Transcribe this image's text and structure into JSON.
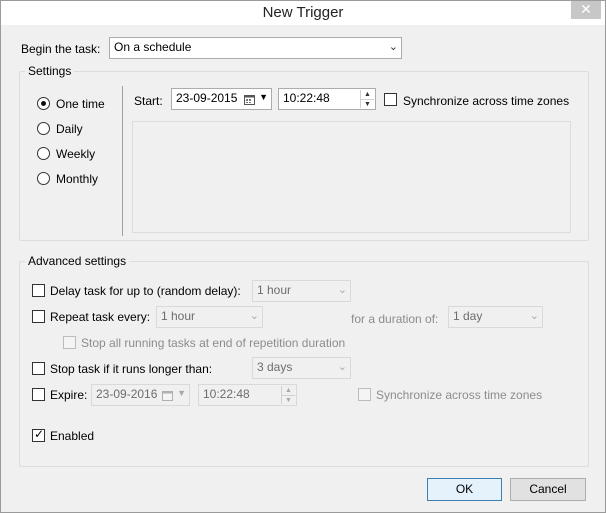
{
  "window": {
    "title": "New Trigger",
    "close_glyph": "✕"
  },
  "begin": {
    "label": "Begin the task:",
    "value": "On a schedule"
  },
  "settings": {
    "title": "Settings",
    "radios": [
      {
        "label": "One time",
        "checked": true
      },
      {
        "label": "Daily",
        "checked": false
      },
      {
        "label": "Weekly",
        "checked": false
      },
      {
        "label": "Monthly",
        "checked": false
      }
    ],
    "start_label": "Start:",
    "start_date": "23-09-2015",
    "start_time": "10:22:48",
    "sync_label": "Synchronize across time zones"
  },
  "advanced": {
    "title": "Advanced settings",
    "delay_label": "Delay task for up to (random delay):",
    "delay_value": "1 hour",
    "repeat_label": "Repeat task every:",
    "repeat_value": "1 hour",
    "duration_label": "for a duration of:",
    "duration_value": "1 day",
    "stop_all_label": "Stop all running tasks at end of repetition duration",
    "stop_long_label": "Stop task if it runs longer than:",
    "stop_long_value": "3 days",
    "expire_label": "Expire:",
    "expire_date": "23-09-2016",
    "expire_time": "10:22:48",
    "expire_sync_label": "Synchronize across time zones",
    "enabled_label": "Enabled"
  },
  "buttons": {
    "ok": "OK",
    "cancel": "Cancel"
  },
  "icons": {
    "dropdown": "chevron-down-icon",
    "calendar": "calendar-icon",
    "spin_up": "spin-up-icon",
    "spin_down": "spin-down-icon",
    "close": "close-icon",
    "check": "check-icon"
  }
}
